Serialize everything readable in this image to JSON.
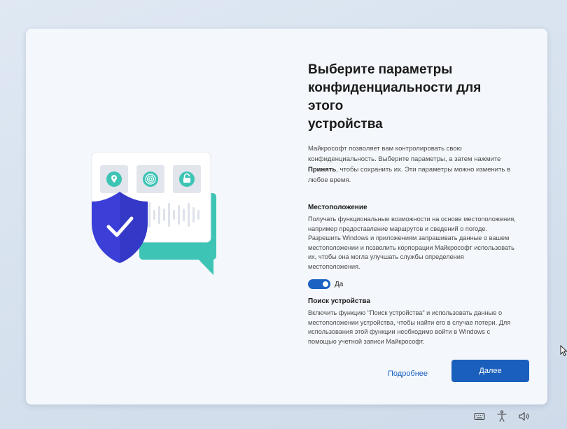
{
  "dialog": {
    "title_line1": "Выберите параметры",
    "title_line2": "конфиденциальности для этого",
    "title_line3": "устройства",
    "intro_before": "Майкрософт позволяет вам контролировать свою конфиденциальность. Выберите параметры, а затем нажмите ",
    "intro_bold": "Принять",
    "intro_after": ", чтобы сохранить их. Эти параметры можно изменить в любое время."
  },
  "location": {
    "title": "Местоположение",
    "text": "Получать функциональные возможности на основе местоположения, например предоставление маршрутов и сведений о погоде. Разрешить Windows и приложениям запрашивать данные о вашем местоположении и позволить корпорации Майкрософт использовать их, чтобы она могла улучшать службы определения местоположения.",
    "toggle_on": true,
    "toggle_label": "Да"
  },
  "find_device": {
    "title": "Поиск устройства",
    "text": "Включить функцию \"Поиск устройства\" и использовать данные о местоположении устройства, чтобы найти его в случае потери. Для использования этой функции необходимо войти в Windows с помощью учетной записи Майкрософт."
  },
  "buttons": {
    "learn_more": "Подробнее",
    "next": "Далее"
  },
  "colors": {
    "accent": "#1b5fbd",
    "shield": "#3b3fd8",
    "teal": "#3ec4b5",
    "card_bg": "#f4f7fb"
  },
  "illustration": {
    "icons": [
      "location-pin-icon",
      "fingerprint-icon",
      "padlock-icon",
      "shield-check-icon"
    ]
  },
  "taskbar": {
    "icons": [
      "keyboard-icon",
      "accessibility-icon",
      "volume-icon"
    ]
  }
}
